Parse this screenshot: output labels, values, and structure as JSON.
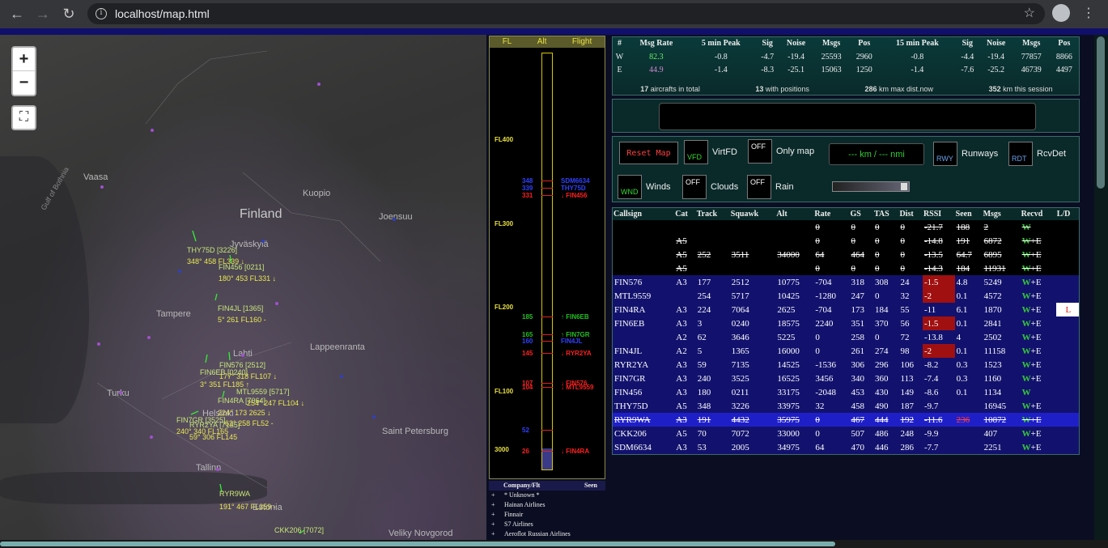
{
  "browser": {
    "url": "localhost/map.html"
  },
  "map": {
    "places": [
      "Finland",
      "Vaasa",
      "Kuopio",
      "Joensuu",
      "Jyväskylä",
      "Tampere",
      "Lahti",
      "Lappeenranta",
      "Turku",
      "Helsinki",
      "Saint Petersburg",
      "Tallinn",
      "Estonia",
      "Veliky Novgorod",
      "Gulf of Bothnia"
    ],
    "labels": [
      {
        "t": "THY75D [3226]",
        "c": "#c8e878"
      },
      {
        "t": "348° 458 FL339 ↓",
        "c": "#e8e850"
      },
      {
        "t": "FIN456 [0211]",
        "c": "#c8e878"
      },
      {
        "t": "180° 453 FL331 ↓",
        "c": "#e8e850"
      },
      {
        "t": "FIN4JL [1365]",
        "c": "#c8e878"
      },
      {
        "t": "5° 261 FL160 -",
        "c": "#e8e850"
      },
      {
        "t": "FIN576 [2512]",
        "c": "#c8e878"
      },
      {
        "t": "FIN6EB [0240]",
        "c": "#c8e878"
      },
      {
        "t": "177° 318 FL107 ↓",
        "c": "#e8e850"
      },
      {
        "t": "3° 351 FL185 ↑",
        "c": "#e8e850"
      },
      {
        "t": "MTL9559 [5717]",
        "c": "#c8e878"
      },
      {
        "t": "FIN4RA [7064]",
        "c": "#c8e878"
      },
      {
        "t": "254° 247 FL104 ↓",
        "c": "#e8e850"
      },
      {
        "t": "224° 173 2625 ↓",
        "c": "#e8e850"
      },
      {
        "t": "FIN7GR [3525]",
        "c": "#c8e878"
      },
      {
        "t": "RYR2YA [7135]",
        "c": "#c8e878"
      },
      {
        "t": "62° 258 FL52 -",
        "c": "#e8e850"
      },
      {
        "t": "240° 340 FL165",
        "c": "#e8e850"
      },
      {
        "t": "59° 306 FL145",
        "c": "#e8e850"
      },
      {
        "t": "RYR9WA",
        "c": "#c8e878"
      },
      {
        "t": "191° 467 FL359 -",
        "c": "#e8e850"
      },
      {
        "t": "CKK206 [7072]",
        "c": "#c8e878"
      }
    ],
    "zoom_in": "+",
    "zoom_out": "−",
    "fullscreen": "⛶"
  },
  "alt": {
    "headers": [
      "FL",
      "Alt",
      "Flight"
    ],
    "levels": [
      "FL400",
      "FL300",
      "FL200",
      "FL100",
      "3000"
    ],
    "marks": [
      {
        "a": "348",
        "f": "SDM6634",
        "c": "#3040ff"
      },
      {
        "a": "339",
        "f": "THY75D",
        "c": "#3040ff"
      },
      {
        "a": "331",
        "f": "↓ FIN456",
        "c": "#ff2020"
      },
      {
        "a": "185",
        "f": "↑ FIN6EB",
        "c": "#20c020"
      },
      {
        "a": "165",
        "f": "↑ FIN7GR",
        "c": "#20c020"
      },
      {
        "a": "160",
        "f": "FIN4JL",
        "c": "#3040ff"
      },
      {
        "a": "145",
        "f": "↓ RYR2YA",
        "c": "#ff2020"
      },
      {
        "a": "107",
        "f": "↓ FIN576",
        "c": "#ff2020"
      },
      {
        "a": "104",
        "f": "↓ MTL9559",
        "c": "#ff2020"
      },
      {
        "a": "52",
        "f": "",
        "c": "#3040ff"
      },
      {
        "a": "26",
        "f": "↓ FIN4RA",
        "c": "#ff2020"
      }
    ]
  },
  "companies": {
    "headers": [
      "Company/Flt",
      "Seen"
    ],
    "rows": [
      "* Unknown *",
      "Hainan Airlines",
      "Finnair",
      "S7 Airlines",
      "Aeroflot Russian Airlines"
    ]
  },
  "stats": {
    "headers": [
      "#",
      "Msg Rate",
      "5 min Peak",
      "Sig",
      "Noise",
      "Msgs",
      "Pos",
      "15 min Peak",
      "Sig",
      "Noise",
      "Msgs",
      "Pos"
    ],
    "rows": [
      [
        "W",
        "82.3",
        "-0.8",
        "-4.7",
        "-19.4",
        "25593",
        "2960",
        "-0.8",
        "-4.4",
        "-19.4",
        "77857",
        "8866"
      ],
      [
        "E",
        "44.9",
        "-1.4",
        "-8.3",
        "-25.1",
        "15063",
        "1250",
        "-1.4",
        "-7.6",
        "-25.2",
        "46739",
        "4497"
      ]
    ],
    "foot": [
      {
        "n": "17",
        "t": "aircrafts in total"
      },
      {
        "n": "13",
        "t": "with positions"
      },
      {
        "n": "286",
        "t": "km max dist.now"
      },
      {
        "n": "352",
        "t": "km this session"
      }
    ]
  },
  "controls": {
    "reset": "Reset Map",
    "vfd": "VFD",
    "virtfd": "VirtFD",
    "off": "OFF",
    "only_map": "Only map",
    "dist": "--- km / --- nmi",
    "rwy": "RWY",
    "runways": "Runways",
    "rdt": "RDT",
    "rcvdet": "RcvDet",
    "wnd": "WND",
    "winds": "Winds",
    "clouds": "Clouds",
    "rain": "Rain"
  },
  "flights": {
    "headers": [
      "Callsign",
      "Cat",
      "Track",
      "Squawk",
      "Alt",
      "Rate",
      "GS",
      "TAS",
      "Dist",
      "RSSI",
      "Seen",
      "Msgs",
      "Recvd",
      "L/D"
    ],
    "rows": [
      [
        "",
        "",
        "",
        "",
        "",
        "0",
        "0",
        "0",
        "0",
        "-21.7",
        "188",
        "2",
        "W",
        ""
      ],
      [
        "",
        "A5",
        "",
        "",
        "",
        "0",
        "0",
        "0",
        "0",
        "-14.8",
        "191",
        "6872",
        "W+E",
        ""
      ],
      [
        "",
        "A5",
        "252",
        "3511",
        "34000",
        "64",
        "464",
        "0",
        "0",
        "-13.5",
        "64.7",
        "6895",
        "W+E",
        ""
      ],
      [
        "",
        "A5",
        "",
        "",
        "",
        "0",
        "0",
        "0",
        "0",
        "-14.3",
        "184",
        "11931",
        "W+E",
        ""
      ],
      [
        "FIN576",
        "A3",
        "177",
        "2512",
        "10775",
        "-704",
        "318",
        "308",
        "24",
        "-1.5",
        "4.8",
        "5249",
        "W+E",
        ""
      ],
      [
        "MTL9559",
        "",
        "254",
        "5717",
        "10425",
        "-1280",
        "247",
        "0",
        "32",
        "-2",
        "0.1",
        "4572",
        "W+E",
        ""
      ],
      [
        "FIN4RA",
        "A3",
        "224",
        "7064",
        "2625",
        "-704",
        "173",
        "184",
        "55",
        "-11",
        "6.1",
        "1870",
        "W+E",
        "L"
      ],
      [
        "FIN6EB",
        "A3",
        "3",
        "0240",
        "18575",
        "2240",
        "351",
        "370",
        "56",
        "-1.5",
        "0.1",
        "2841",
        "W+E",
        ""
      ],
      [
        "",
        "A2",
        "62",
        "3646",
        "5225",
        "0",
        "258",
        "0",
        "72",
        "-13.8",
        "4",
        "2502",
        "W+E",
        ""
      ],
      [
        "FIN4JL",
        "A2",
        "5",
        "1365",
        "16000",
        "0",
        "261",
        "274",
        "98",
        "-2",
        "0.1",
        "11158",
        "W+E",
        ""
      ],
      [
        "RYR2YA",
        "A3",
        "59",
        "7135",
        "14525",
        "-1536",
        "306",
        "296",
        "106",
        "-8.2",
        "0.3",
        "1523",
        "W+E",
        ""
      ],
      [
        "FIN7GR",
        "A3",
        "240",
        "3525",
        "16525",
        "3456",
        "340",
        "360",
        "113",
        "-7.4",
        "0.3",
        "1160",
        "W+E",
        ""
      ],
      [
        "FIN456",
        "A3",
        "180",
        "0211",
        "33175",
        "-2048",
        "453",
        "430",
        "149",
        "-8.6",
        "0.1",
        "1134",
        "W",
        ""
      ],
      [
        "THY75D",
        "A5",
        "348",
        "3226",
        "33975",
        "32",
        "458",
        "490",
        "187",
        "-9.7",
        "",
        "16945",
        "W+E",
        ""
      ],
      [
        "RYR9WA",
        "A3",
        "191",
        "4432",
        "35975",
        "0",
        "467",
        "444",
        "192",
        "-11.6",
        "236",
        "10872",
        "W+E",
        ""
      ],
      [
        "CKK206",
        "A5",
        "70",
        "7072",
        "33000",
        "0",
        "507",
        "486",
        "248",
        "-9.9",
        "",
        "407",
        "W+E",
        ""
      ],
      [
        "SDM6634",
        "A3",
        "53",
        "2005",
        "34975",
        "64",
        "470",
        "446",
        "286",
        "-7.7",
        "",
        "2251",
        "W+E",
        ""
      ]
    ]
  }
}
